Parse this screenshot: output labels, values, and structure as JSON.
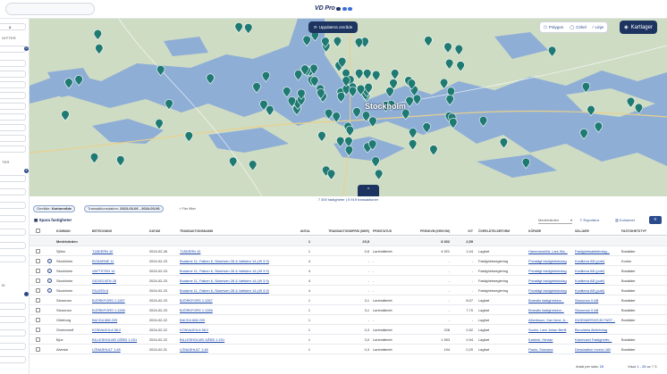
{
  "header": {
    "logo_text": "VD Pro",
    "logo_dot_colors": [
      "#1d3461",
      "#3a6fd8",
      "#3a6fd8"
    ]
  },
  "sidebar": {
    "section1_label": "GIFTER",
    "section1_badge": "0",
    "section2_label": "TER",
    "section2_badge": "4",
    "section3_label": "ik",
    "first_field_text": "å"
  },
  "map": {
    "update_button": "Uppdatera område",
    "draw_tools": {
      "polygon": "Polygon",
      "circle": "Cirkel",
      "line": "Linje"
    },
    "layers_button": "Kartlager",
    "city_label": "Stockholm",
    "collapse_icon": "^",
    "marker_color": "#1f7a72",
    "land_color": "#cfdcc4",
    "water_color": "#8eaed6"
  },
  "result_count": "7 300 fastigheter | 5 919 transaktioner",
  "filters": [
    {
      "label": "Område:",
      "value": "Kartområde"
    },
    {
      "label": "Transaktionsdatum:",
      "value": "2023-03-06 - 2024-03-06"
    }
  ],
  "more_filters": "+ Fler filter",
  "table_toolbar": {
    "save_label": "Spara fastigheter",
    "dropdown_label": "Medelvärden",
    "export_label": "Exportera",
    "columns_label": "Kolumner"
  },
  "table": {
    "columns": [
      "KOMMUN",
      "BETECKNING",
      "DATUM",
      "TRANSAKTIONSNAMN",
      "ANTAL",
      "TRANSAKTIONSPRIS (Mkr)",
      "PRISSTATUS",
      "PRIS/KVM (kr/kvm)",
      "K/T",
      "ÖVERLÅTELSEFORM",
      "KÖPARE",
      "SÄLJARE",
      "FASTIGHETSTYP"
    ],
    "average_row": {
      "label": "Medelvärden",
      "antal": "1",
      "pris": "20,5",
      "kvm": "8 302",
      "kt": "2,59"
    },
    "rows": [
      {
        "kommun": "Sjöbo",
        "beteckning": "TJÄDERN 10",
        "datum": "2024-02-26",
        "namn": "TJÄDERN 10",
        "antal": "1",
        "pris": "0,6",
        "status": "Lantmäteriet",
        "kvm": "4 921",
        "kt": "1,04",
        "form": "Lagfart",
        "kopare": "Hammarsköld, Lars Wa...",
        "saljare": "Fastighetsaktiebolag...",
        "typ": "Bostäder",
        "info": false,
        "link": true
      },
      {
        "kommun": "Stockholm",
        "beteckning": "BODARNE 11",
        "datum": "2024-02-23",
        "namn": "Bodarne 11, Falken 6, Sickelven 28 & Vaftsten 14 (49 3 9)",
        "antal": "4",
        "pris": "-",
        "status": "-",
        "kvm": "-",
        "kt": "-",
        "form": "Fastighetsreglering",
        "kopare": "Privatägt fastighetsbolag",
        "saljare": "Kvalitena AB (publ)",
        "typ": "Kontor",
        "info": true,
        "link": true
      },
      {
        "kommun": "Stockholm",
        "beteckning": "VAFTSTEN 14",
        "datum": "2024-02-23",
        "namn": "Bodarne 11, Falken 6, Sickelven 28 & Vaftsten 14 (49 3 9)",
        "antal": "4",
        "pris": "-",
        "status": "-",
        "kvm": "-",
        "kt": "-",
        "form": "Fastighetsreglering",
        "kopare": "Privatägt fastighetsbolag",
        "saljare": "Kvalitena AB (publ)",
        "typ": "Bostäder",
        "info": true,
        "link": true
      },
      {
        "kommun": "Stockholm",
        "beteckning": "SICKELVEN 28",
        "datum": "2024-02-23",
        "namn": "Bodarne 11, Falken 6, Sickelven 28 & Vaftsten 14 (49 3 9)",
        "antal": "4",
        "pris": "-",
        "status": "-",
        "kvm": "-",
        "kt": "-",
        "form": "Fastighetsreglering",
        "kopare": "Privatägt fastighetsbolag",
        "saljare": "Kvalitena AB (publ)",
        "typ": "Bostäder",
        "info": true,
        "link": true
      },
      {
        "kommun": "Stockholm",
        "beteckning": "FALKEN 6",
        "datum": "2024-02-23",
        "namn": "Bodarne 11, Falken 6, Sickelven 28 & Vaftsten 14 (49 3 9)",
        "antal": "4",
        "pris": "-",
        "status": "-",
        "kvm": "-",
        "kt": "-",
        "form": "Fastighetsreglering",
        "kopare": "Privatägt fastighetsbolag",
        "saljare": "Kvalitena AB (publ)",
        "typ": "Bostäder",
        "info": true,
        "link": true
      },
      {
        "kommun": "Storuman",
        "beteckning": "BJÖRKFORS 1:1287",
        "datum": "2024-02-23",
        "namn": "BJÖRKFORS 1:1287",
        "antal": "1",
        "pris": "3,1",
        "status": "Lantmäteriet",
        "kvm": "-",
        "kt": "8,07",
        "form": "Lagfart",
        "kopare": "Borealis fastighetsinv...",
        "saljare": "Storuman 0 AB",
        "typ": "Bostäder",
        "info": false,
        "link": true
      },
      {
        "kommun": "Storuman",
        "beteckning": "BJÖRKFORS 1:1286",
        "datum": "2024-02-23",
        "namn": "BJÖRKFORS 1:1286",
        "antal": "1",
        "pris": "3,1",
        "status": "Lantmäteriet",
        "kvm": "-",
        "kt": "7,70",
        "form": "Lagfart",
        "kopare": "Borealis fastighetsinv...",
        "saljare": "Storuman 0 AB",
        "typ": "Bostäder",
        "info": false,
        "link": true
      },
      {
        "kommun": "Göteborg",
        "beteckning": "BACKA 866:209",
        "datum": "2024-02-22",
        "namn": "BACKA 866:209",
        "antal": "1",
        "pris": "-",
        "status": "-",
        "kvm": "-",
        "kt": "-",
        "form": "Lagfart",
        "kopare": "Albertsson, Karl Arne, A...",
        "saljare": "INGEMARSHÖJD FAST...",
        "typ": "Bostäder",
        "info": false,
        "link": true
      },
      {
        "kommun": "Övertorneå",
        "beteckning": "KONVAJKILA 58:2",
        "datum": "2024-02-22",
        "namn": "KONVAJKILA 58:2",
        "antal": "1",
        "pris": "0,3",
        "status": "Lantmäteriet",
        "kvm": "228",
        "kt": "0,52",
        "form": "Lagfart",
        "kopare": "Svahn, Lars Johan Bertil",
        "saljare": "Beculiaha Aktiebolag",
        "typ": "",
        "info": false,
        "link": true
      },
      {
        "kommun": "Bjuv",
        "beteckning": "BILLESHOLMS GÅRD 1:201",
        "datum": "2024-02-22",
        "namn": "BILLESHOLMS GÅRD 1:201",
        "antal": "1",
        "pris": "3,0",
        "status": "Lantmäteriet",
        "kvm": "1 953",
        "kt": "0,94",
        "form": "Lagfart",
        "kopare": "Karlesh, Hevian",
        "saljare": "Kärnhuset Fastigheter...",
        "typ": "Bostäder",
        "info": false,
        "link": true
      },
      {
        "kommun": "Alvesta",
        "beteckning": "LÖNASHULT 1:48",
        "datum": "2024-02-21",
        "namn": "LÖNASHULT 1:48",
        "antal": "1",
        "pris": "0,3",
        "status": "Lantmäteriet",
        "kvm": "194",
        "kt": "0,20",
        "form": "Lagfart",
        "kopare": "Paulo, Snezana",
        "saljare": "Dessination Invest i AB",
        "typ": "Bostäder",
        "info": false,
        "link": true
      }
    ]
  },
  "footer": {
    "rows_per_page_label": "Antal per sida:",
    "rows_per_page_value": "25",
    "page_label": "Visar",
    "page_range": "1 - 25",
    "page_of": "av 7 3"
  }
}
